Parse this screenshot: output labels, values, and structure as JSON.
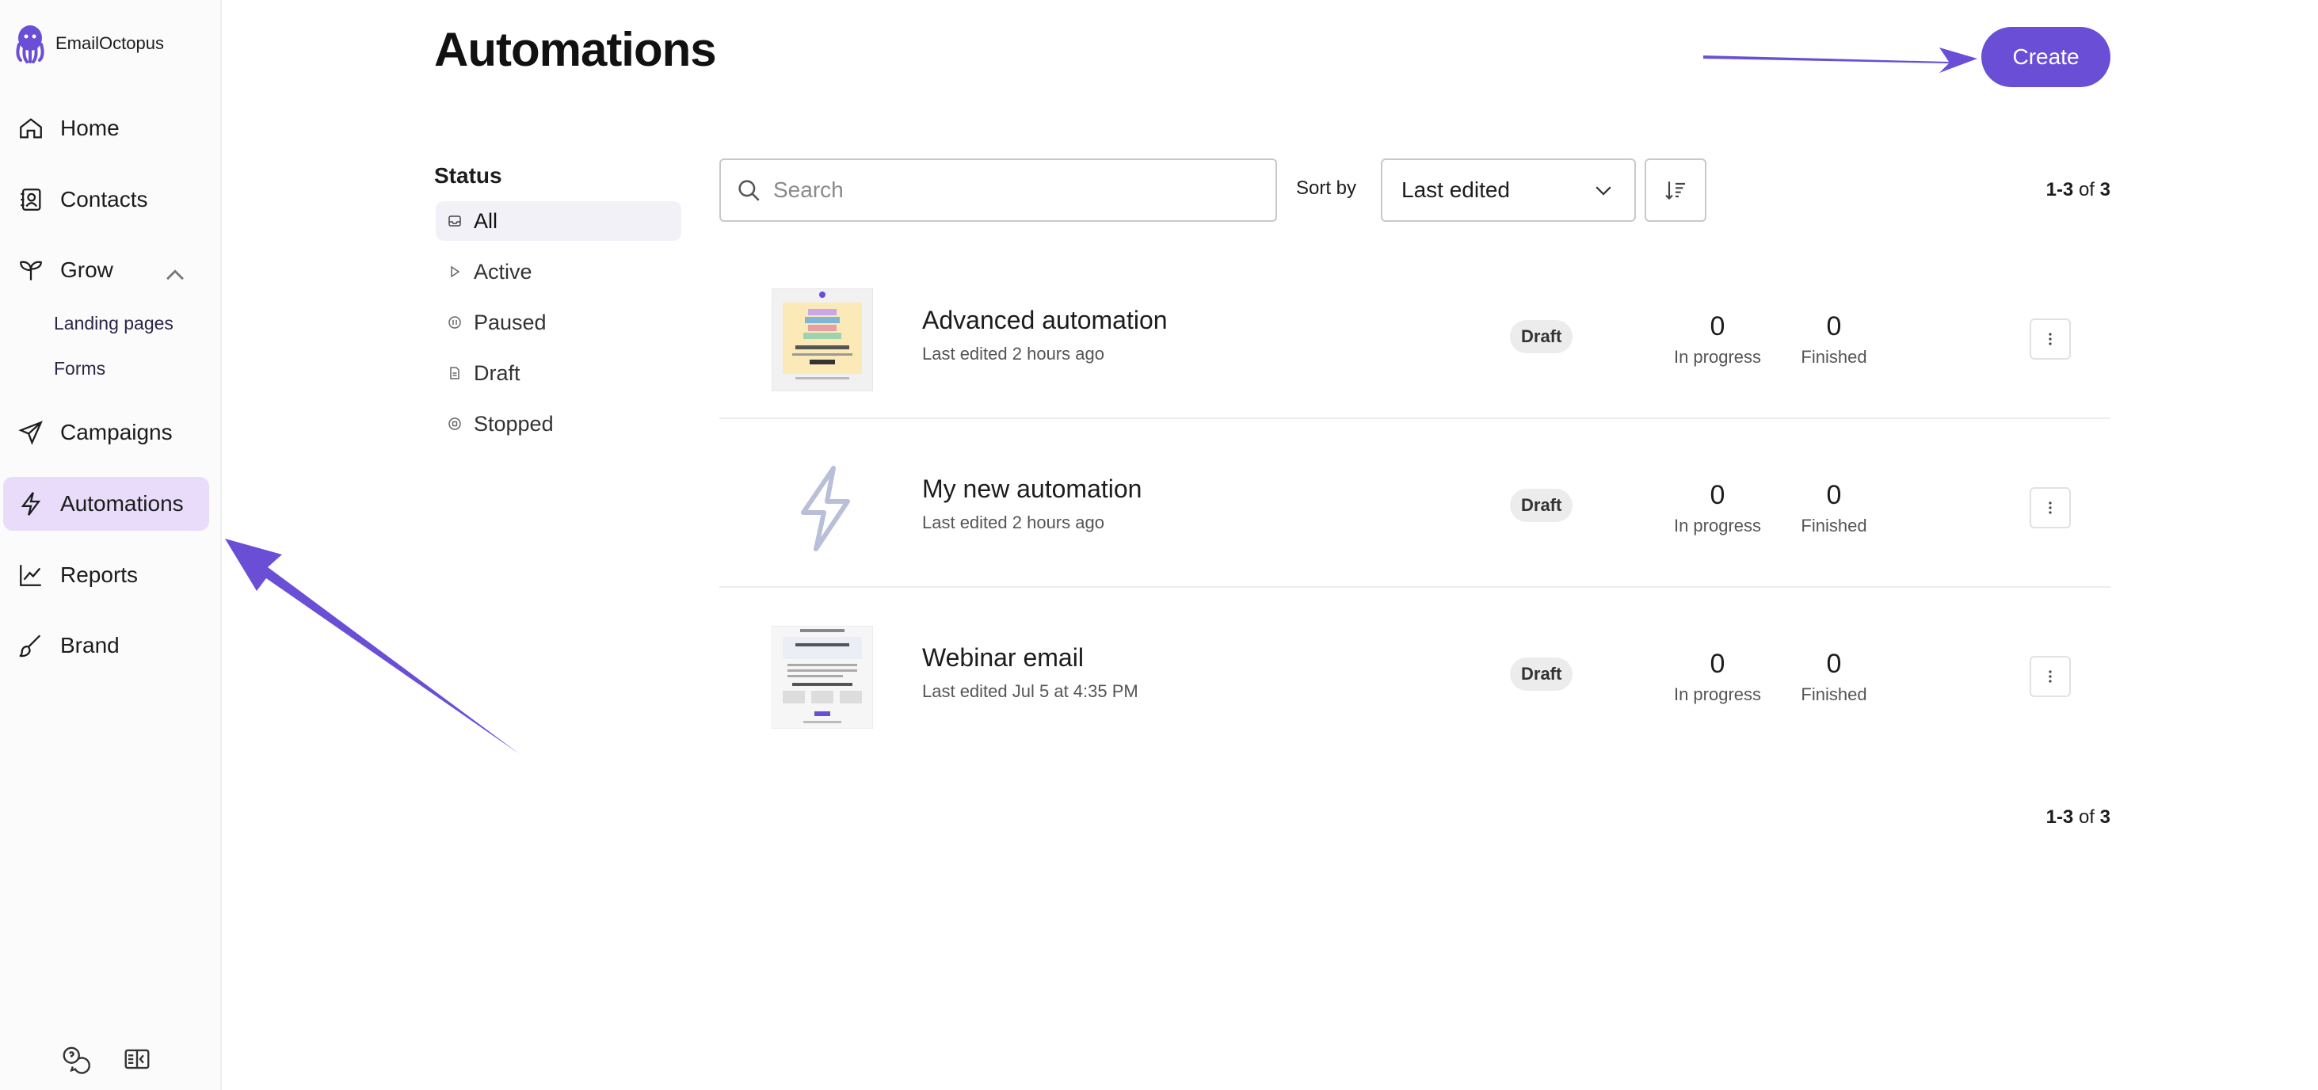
{
  "sidebar": {
    "brand": "EmailOctopus",
    "nav": {
      "home": "Home",
      "contacts": "Contacts",
      "grow": "Grow",
      "landing_pages": "Landing pages",
      "forms": "Forms",
      "campaigns": "Campaigns",
      "automations": "Automations",
      "reports": "Reports",
      "brand": "Brand"
    }
  },
  "header": {
    "title": "Automations",
    "create_label": "Create"
  },
  "filters": {
    "title": "Status",
    "items": [
      "All",
      "Active",
      "Paused",
      "Draft",
      "Stopped"
    ],
    "selected": "All"
  },
  "toolbar": {
    "search_placeholder": "Search",
    "sort_label": "Sort by",
    "sort_value": "Last edited"
  },
  "pagination": {
    "range": "1-3",
    "of_text": "of",
    "total": "3"
  },
  "automations": [
    {
      "name": "Advanced automation",
      "edited": "Last edited 2 hours ago",
      "status": "Draft",
      "in_progress": "0",
      "in_progress_label": "In progress",
      "finished": "0",
      "finished_label": "Finished"
    },
    {
      "name": "My new automation",
      "edited": "Last edited 2 hours ago",
      "status": "Draft",
      "in_progress": "0",
      "in_progress_label": "In progress",
      "finished": "0",
      "finished_label": "Finished"
    },
    {
      "name": "Webinar email",
      "edited": "Last edited Jul 5 at 4:35 PM",
      "status": "Draft",
      "in_progress": "0",
      "in_progress_label": "In progress",
      "finished": "0",
      "finished_label": "Finished"
    }
  ],
  "colors": {
    "accent": "#6a4fd6",
    "active_nav_bg": "#e8dcfa"
  }
}
